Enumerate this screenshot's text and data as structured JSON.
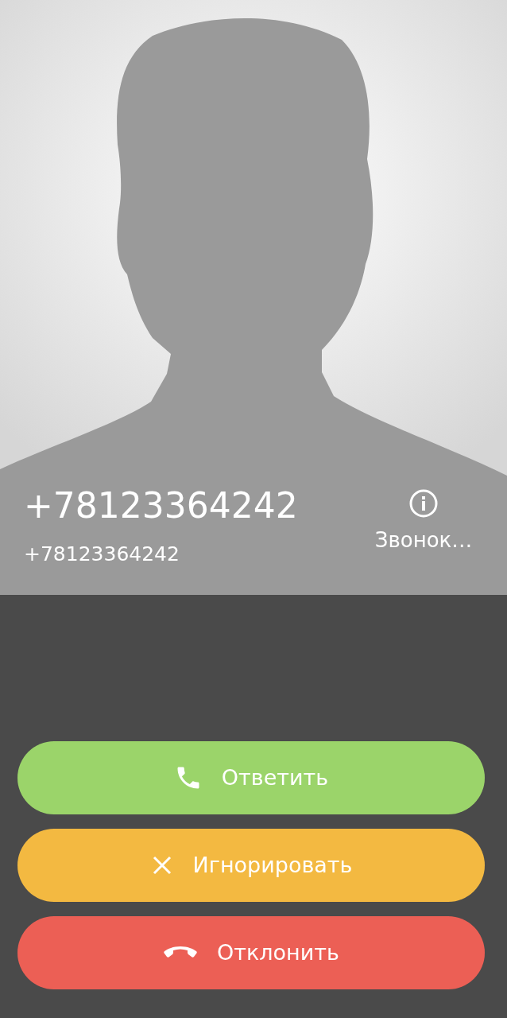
{
  "caller": {
    "name": "+78123364242",
    "number": "+78123364242",
    "info_label": "Звонок…"
  },
  "buttons": [
    {
      "kind": "answer",
      "label": "Ответить",
      "color": "#9bd46a"
    },
    {
      "kind": "ignore",
      "label": "Игнорировать",
      "color": "#f3b941"
    },
    {
      "kind": "decline",
      "label": "Отклонить",
      "color": "#ec5f55"
    }
  ]
}
